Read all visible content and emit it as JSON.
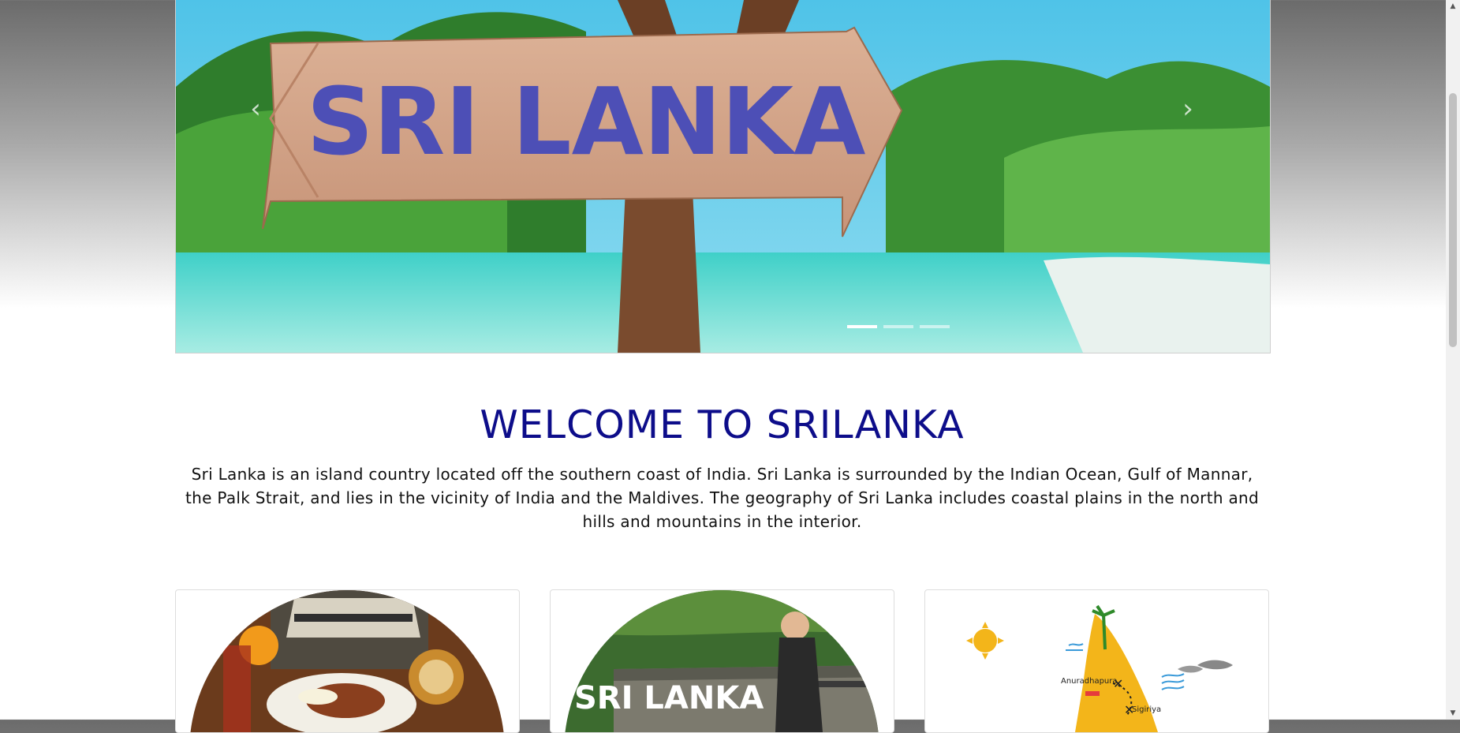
{
  "hero": {
    "sign_text": "SRI LANKA",
    "prev_icon": "chevron-left-icon",
    "next_icon": "chevron-right-icon",
    "prev_glyph": "‹",
    "next_glyph": "›",
    "slide_count": 3,
    "active_slide": 1
  },
  "welcome": {
    "title": "WELCOME TO SRILANKA",
    "description": "Sri Lanka is an island country located off the southern coast of India. Sri Lanka is surrounded by the Indian Ocean, Gulf of Mannar, the Palk Strait, and lies in the vicinity of India and the Maldives. The geography of Sri Lanka includes coastal plains in the north and hills and mountains in the interior."
  },
  "cards": [
    {
      "image": "food-photo"
    },
    {
      "image": "railway-bridge-photo",
      "overlay_text": "SRI LANKA"
    },
    {
      "image": "island-map",
      "labels": [
        "Anuradhapura",
        "Sigiriya"
      ]
    }
  ],
  "colors": {
    "title": "#0d0d8a",
    "map_island": "#f3b51a"
  },
  "scrollbar": {
    "up_glyph": "▲",
    "down_glyph": "▼"
  }
}
